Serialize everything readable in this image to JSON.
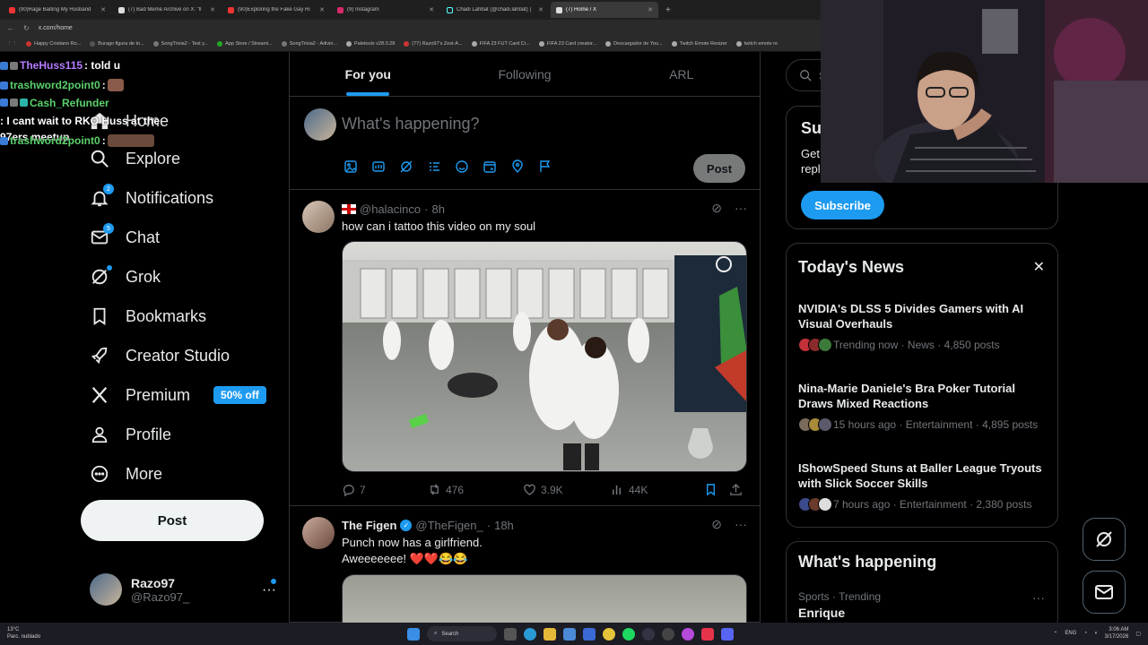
{
  "browser": {
    "tabs": [
      {
        "label": "(90)Rage Baiting My Husband",
        "active": false
      },
      {
        "label": "(7) Bad Meme Archive on X: \"ll",
        "active": false
      },
      {
        "label": "(90)Exploring the Fake Gay Ri",
        "active": false
      },
      {
        "label": "(9) Instagram",
        "active": false
      },
      {
        "label": "Chadi Lahbat (@chadi.lahbat) |",
        "active": false
      },
      {
        "label": "(7) Home / X",
        "active": true
      }
    ],
    "new_tab": "+",
    "url": "x.com/home",
    "bookmarks": [
      "Happy Cristiano Ro...",
      "Burago figura de to...",
      "SongTrivia2 - Test y...",
      "App Store / Streami...",
      "SongTrivia2 - Adivin...",
      "Paletools v28.0.28",
      "(77) Razo97's Zest-A...",
      "FIFA 23 FUT Card Cr...",
      "FIFA 23 Card creator...",
      "Descargador de You...",
      "Twitch Emote Resizer",
      "twitch emote re"
    ]
  },
  "chat_overlay": [
    {
      "user": "TheHuss115",
      "message": ": told u",
      "emote": false
    },
    {
      "user": "trashword2point0",
      "message": ":",
      "emote": true
    },
    {
      "user": "Cash_Refunder",
      "message": ": I cant wait to RKO Huss at the 97ers meetup",
      "emote": false
    },
    {
      "user": "trashword2point0",
      "message": ":",
      "emote": true
    }
  ],
  "nav": {
    "home": "Home",
    "explore": "Explore",
    "notifications": "Notifications",
    "notifications_badge": "2",
    "chat": "Chat",
    "chat_badge": "5",
    "grok": "Grok",
    "bookmarks": "Bookmarks",
    "creator_studio": "Creator Studio",
    "premium": "Premium",
    "premium_pill": "50% off",
    "profile": "Profile",
    "more": "More",
    "post_button": "Post",
    "account_name": "Razo97",
    "account_handle": "@Razo97_",
    "account_more": "···"
  },
  "feed": {
    "tabs": [
      "For you",
      "Following",
      "ARL"
    ],
    "active_tab": "For you",
    "compose_placeholder": "What's happening?",
    "compose_post": "Post",
    "tweets": [
      {
        "handle": "@halacinco",
        "time": "8h",
        "text": "how can i tattoo this video on my soul",
        "replies": "7",
        "reposts": "476",
        "likes": "3.9K",
        "views": "44K"
      },
      {
        "name": "The Figen",
        "handle": "@TheFigen_",
        "time": "18h",
        "text": "Punch now has a girlfriend.\nAweeeeeee! ❤️❤️😂😂"
      }
    ]
  },
  "right": {
    "search_placeholder": "Se",
    "subscribe_title": "Su",
    "subscribe_body_1": "Get",
    "subscribe_body_2": "repl",
    "subscribe_button": "Subscribe",
    "news_title": "Today's News",
    "news_close": "✕",
    "news": [
      {
        "title": "NVIDIA's DLSS 5 Divides Gamers with AI Visual Overhauls",
        "meta": "Trending now · News · 4,850 posts"
      },
      {
        "title": "Nina-Marie Daniele's Bra Poker Tutorial Draws Mixed Reactions",
        "meta": "15 hours ago · Entertainment · 4,895 posts"
      },
      {
        "title": "IShowSpeed Stuns at Baller League Tryouts with Slick Soccer Skills",
        "meta": "7 hours ago · Entertainment · 2,380 posts"
      }
    ],
    "happening_title": "What's happening",
    "trend_meta": "Sports · Trending",
    "trend_name": "Enrique",
    "trend_more": "···"
  },
  "taskbar": {
    "weather_temp": "13°C",
    "weather_desc": "Parc. nublado",
    "search": "Search",
    "lang": "ENG",
    "time": "3:06 AM",
    "date": "3/17/2026"
  },
  "colors": {
    "accent": "#1d9bf0",
    "background": "#000000",
    "border": "#2f3336",
    "muted_text": "#71767b"
  }
}
